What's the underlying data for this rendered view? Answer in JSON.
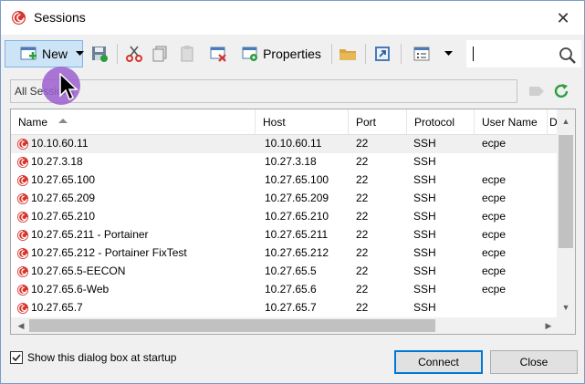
{
  "window": {
    "title": "Sessions"
  },
  "toolbar": {
    "new_label": "New",
    "properties_label": "Properties",
    "search_value": ""
  },
  "filter": {
    "value": "All Sessions"
  },
  "table": {
    "columns": [
      "Name",
      "Host",
      "Port",
      "Protocol",
      "User Name",
      "D"
    ],
    "rows": [
      {
        "name": "10.10.60.11",
        "host": "10.10.60.11",
        "port": "22",
        "protocol": "SSH",
        "user": "ecpe"
      },
      {
        "name": "10.27.3.18",
        "host": "10.27.3.18",
        "port": "22",
        "protocol": "SSH",
        "user": ""
      },
      {
        "name": "10.27.65.100",
        "host": "10.27.65.100",
        "port": "22",
        "protocol": "SSH",
        "user": "ecpe"
      },
      {
        "name": "10.27.65.209",
        "host": "10.27.65.209",
        "port": "22",
        "protocol": "SSH",
        "user": "ecpe"
      },
      {
        "name": "10.27.65.210",
        "host": "10.27.65.210",
        "port": "22",
        "protocol": "SSH",
        "user": "ecpe"
      },
      {
        "name": "10.27.65.211 - Portainer",
        "host": "10.27.65.211",
        "port": "22",
        "protocol": "SSH",
        "user": "ecpe"
      },
      {
        "name": "10.27.65.212 - Portainer FixTest",
        "host": "10.27.65.212",
        "port": "22",
        "protocol": "SSH",
        "user": "ecpe"
      },
      {
        "name": "10.27.65.5-EECON",
        "host": "10.27.65.5",
        "port": "22",
        "protocol": "SSH",
        "user": "ecpe"
      },
      {
        "name": "10.27.65.6-Web",
        "host": "10.27.65.6",
        "port": "22",
        "protocol": "SSH",
        "user": "ecpe"
      },
      {
        "name": "10.27.65.7",
        "host": "10.27.65.7",
        "port": "22",
        "protocol": "SSH",
        "user": ""
      }
    ]
  },
  "footer": {
    "startup_label": "Show this dialog box at startup",
    "startup_checked": true,
    "connect_label": "Connect",
    "close_label": "Close"
  },
  "icons": {
    "app": "swirl-icon",
    "session": "swirl-icon",
    "new": "new-session-icon",
    "save": "save-icon",
    "cut": "scissors-icon",
    "copy": "copy-icon",
    "paste": "paste-icon",
    "delete": "delete-icon",
    "properties": "properties-icon",
    "folder": "folder-icon",
    "shortcut": "shortcut-icon",
    "view": "view-list-icon",
    "search": "search-icon",
    "refresh": "refresh-icon"
  },
  "colors": {
    "accent": "#0078d7",
    "selection": "#cde4f7",
    "brand": "#d9342b",
    "refresh": "#2e9e3e",
    "pointer_highlight": "#9b5fd0"
  }
}
